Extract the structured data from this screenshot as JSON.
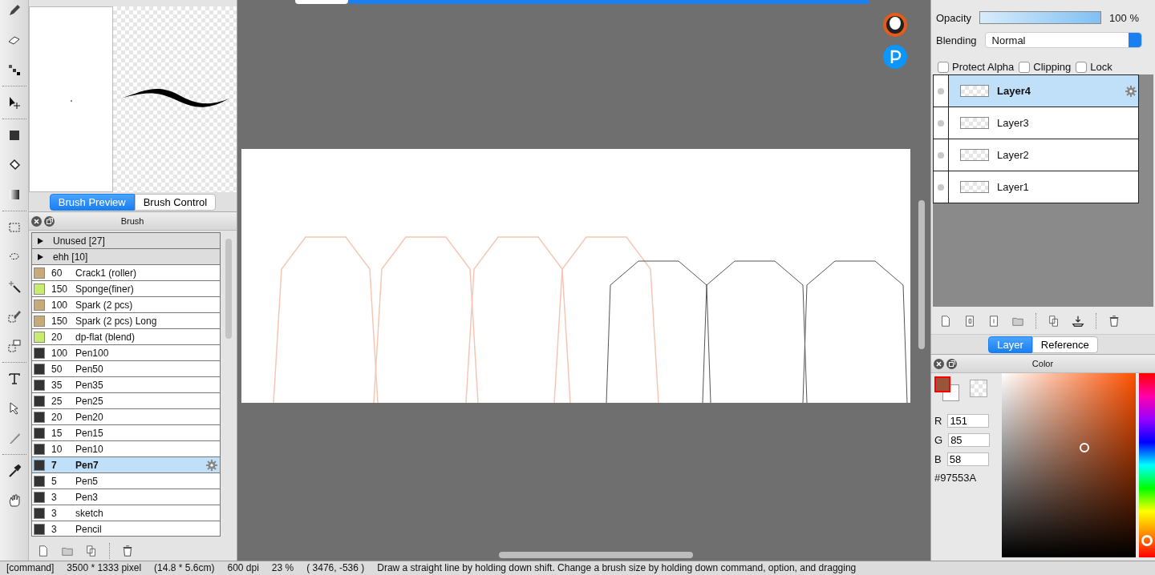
{
  "brush_preview_tabs": [
    {
      "label": "Brush Preview",
      "selected": true
    },
    {
      "label": "Brush Control",
      "selected": false
    }
  ],
  "brush_panel": {
    "title": "Brush",
    "items": [
      {
        "kind": "group",
        "label": "Unused [27]",
        "expanded": false
      },
      {
        "kind": "group",
        "label": "ehh [10]",
        "expanded": false
      },
      {
        "kind": "brush",
        "color": "#c8aa78",
        "size": "60",
        "name": "Crack1 (roller)",
        "selected": false
      },
      {
        "kind": "brush",
        "color": "#c8ec70",
        "size": "150",
        "name": "Sponge(finer)",
        "selected": false
      },
      {
        "kind": "brush",
        "color": "#c8aa78",
        "size": "100",
        "name": "Spark (2 pcs)",
        "selected": false
      },
      {
        "kind": "brush",
        "color": "#c8aa78",
        "size": "150",
        "name": "Spark (2 pcs) Long",
        "selected": false
      },
      {
        "kind": "brush",
        "color": "#c8ec70",
        "size": "20",
        "name": "dp-flat (blend)",
        "selected": false
      },
      {
        "kind": "brush",
        "color": "#333333",
        "size": "100",
        "name": "Pen100",
        "selected": false
      },
      {
        "kind": "brush",
        "color": "#333333",
        "size": "50",
        "name": "Pen50",
        "selected": false
      },
      {
        "kind": "brush",
        "color": "#333333",
        "size": "35",
        "name": "Pen35",
        "selected": false
      },
      {
        "kind": "brush",
        "color": "#333333",
        "size": "25",
        "name": "Pen25",
        "selected": false
      },
      {
        "kind": "brush",
        "color": "#333333",
        "size": "20",
        "name": "Pen20",
        "selected": false
      },
      {
        "kind": "brush",
        "color": "#333333",
        "size": "15",
        "name": "Pen15",
        "selected": false
      },
      {
        "kind": "brush",
        "color": "#333333",
        "size": "10",
        "name": "Pen10",
        "selected": false
      },
      {
        "kind": "brush",
        "color": "#333333",
        "size": "7",
        "name": "Pen7",
        "selected": true
      },
      {
        "kind": "brush",
        "color": "#333333",
        "size": "5",
        "name": "Pen5",
        "selected": false
      },
      {
        "kind": "brush",
        "color": "#333333",
        "size": "3",
        "name": "Pen3",
        "selected": false
      },
      {
        "kind": "brush",
        "color": "#333333",
        "size": "3",
        "name": "sketch",
        "selected": false
      },
      {
        "kind": "brush",
        "color": "#333333",
        "size": "3",
        "name": "Pencil",
        "selected": false
      }
    ]
  },
  "layer_panel": {
    "opacity_label": "Opacity",
    "opacity": {
      "level": 1
    },
    "opacity_value": "100 %",
    "blending_label": "Blending",
    "blending": "Normal",
    "options": [
      {
        "label": "Protect Alpha",
        "checked": false
      },
      {
        "label": "Clipping",
        "checked": false
      },
      {
        "label": "Lock",
        "checked": false
      }
    ],
    "layers": [
      {
        "name": "Layer4",
        "selected": true
      },
      {
        "name": "Layer3",
        "selected": false
      },
      {
        "name": "Layer2",
        "selected": false
      },
      {
        "name": "Layer1",
        "selected": false
      }
    ]
  },
  "layer_tabs": [
    {
      "label": "Layer",
      "selected": true
    },
    {
      "label": "Reference",
      "selected": false
    }
  ],
  "color_panel": {
    "title": "Color",
    "hue_slider": {
      "level": 0.06
    },
    "channels": [
      {
        "label": "R",
        "value": "151"
      },
      {
        "label": "G",
        "value": "85"
      },
      {
        "label": "B",
        "value": "58"
      }
    ],
    "hex": "#97553A"
  },
  "status_bar": {
    "mode": "[command]",
    "size": "3500 * 1333 pixel",
    "physical": "(14.8 * 5.6cm)",
    "dpi": "600 dpi",
    "zoom": "23 %",
    "cursor": "( 3476, -536 )",
    "hint": "Draw a straight line by holding down shift. Change a brush size by holding down command, option, and dragging"
  }
}
